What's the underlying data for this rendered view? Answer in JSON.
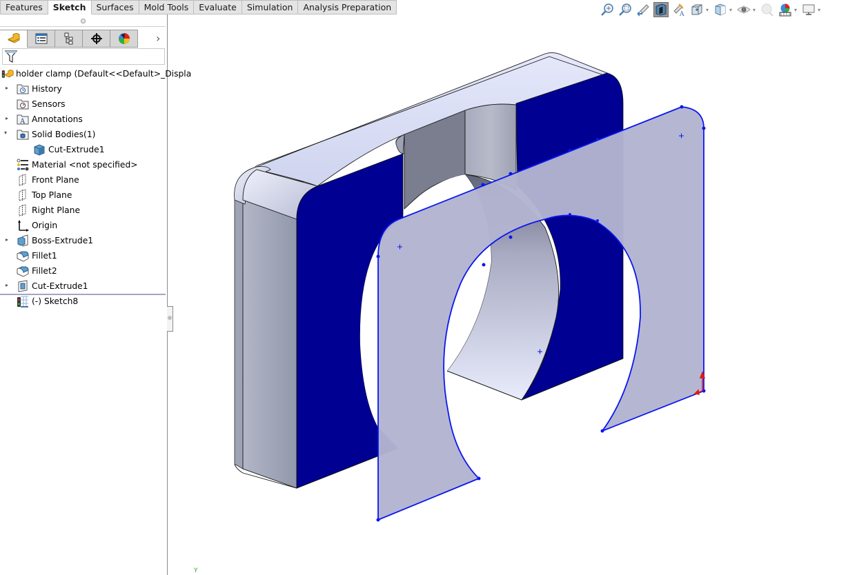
{
  "command_tabs": [
    {
      "label": "Features",
      "active": false
    },
    {
      "label": "Sketch",
      "active": true
    },
    {
      "label": "Surfaces",
      "active": false
    },
    {
      "label": "Mold Tools",
      "active": false
    },
    {
      "label": "Evaluate",
      "active": false
    },
    {
      "label": "Simulation",
      "active": false
    },
    {
      "label": "Analysis Preparation",
      "active": false
    }
  ],
  "panel_tabs": [
    {
      "icon": "featuremanager-icon"
    },
    {
      "icon": "propertymanager-icon"
    },
    {
      "icon": "configurationmanager-icon"
    },
    {
      "icon": "dimxpertmanager-icon"
    },
    {
      "icon": "displaymanager-icon"
    }
  ],
  "panel_more": "›",
  "filter": {
    "icon": "filter-icon",
    "value": ""
  },
  "tree": {
    "root": "holder clamp  (Default<<Default>_Displa",
    "items": [
      {
        "label": "History",
        "icon": "history-folder-icon",
        "expandable": true,
        "expanded": false
      },
      {
        "label": "Sensors",
        "icon": "sensors-folder-icon",
        "expandable": false
      },
      {
        "label": "Annotations",
        "icon": "annotations-folder-icon",
        "expandable": true,
        "expanded": false
      },
      {
        "label": "Solid Bodies(1)",
        "icon": "solid-bodies-folder-icon",
        "expandable": true,
        "expanded": true
      },
      {
        "label": "Cut-Extrude1",
        "icon": "solid-body-icon",
        "expandable": false,
        "child": true
      },
      {
        "label": "Material <not specified>",
        "icon": "material-icon",
        "expandable": false
      },
      {
        "label": "Front Plane",
        "icon": "plane-icon",
        "expandable": false
      },
      {
        "label": "Top Plane",
        "icon": "plane-icon",
        "expandable": false
      },
      {
        "label": "Right Plane",
        "icon": "plane-icon",
        "expandable": false
      },
      {
        "label": "Origin",
        "icon": "origin-icon",
        "expandable": false
      },
      {
        "label": "Boss-Extrude1",
        "icon": "boss-extrude-icon",
        "expandable": true,
        "expanded": false
      },
      {
        "label": "Fillet1",
        "icon": "fillet-icon",
        "expandable": false
      },
      {
        "label": "Fillet2",
        "icon": "fillet-icon",
        "expandable": false
      },
      {
        "label": "Cut-Extrude1",
        "icon": "cut-extrude-icon",
        "expandable": true,
        "expanded": false
      },
      {
        "label": "(-) Sketch8",
        "icon": "sketch-icon",
        "expandable": false
      }
    ]
  },
  "view_toolbar": [
    {
      "icon": "zoom-to-fit-icon",
      "dropdown": false,
      "pressed": false
    },
    {
      "icon": "zoom-to-area-icon",
      "dropdown": false,
      "pressed": false
    },
    {
      "icon": "previous-view-icon",
      "dropdown": false,
      "pressed": false
    },
    {
      "icon": "section-view-icon",
      "dropdown": false,
      "pressed": true
    },
    {
      "icon": "dynamic-annotation-views-icon",
      "dropdown": false,
      "pressed": false
    },
    {
      "icon": "view-orientation-icon",
      "dropdown": true,
      "pressed": false
    },
    {
      "icon": "display-style-icon",
      "dropdown": true,
      "pressed": false
    },
    {
      "icon": "hide-show-items-icon",
      "dropdown": true,
      "pressed": false
    },
    {
      "icon": "edit-appearance-icon",
      "dropdown": false,
      "pressed": false
    },
    {
      "icon": "apply-scene-icon",
      "dropdown": true,
      "pressed": false
    },
    {
      "icon": "view-settings-icon",
      "dropdown": true,
      "pressed": false
    }
  ],
  "triad_label": "Y",
  "colors": {
    "section_face": "#000093",
    "sketch_line": "#0a16f0",
    "sketch_fill": "#b3b4d0",
    "top_face": "#d4d8f2",
    "side_face": "#9299ab",
    "relation_red": "#e01818"
  }
}
